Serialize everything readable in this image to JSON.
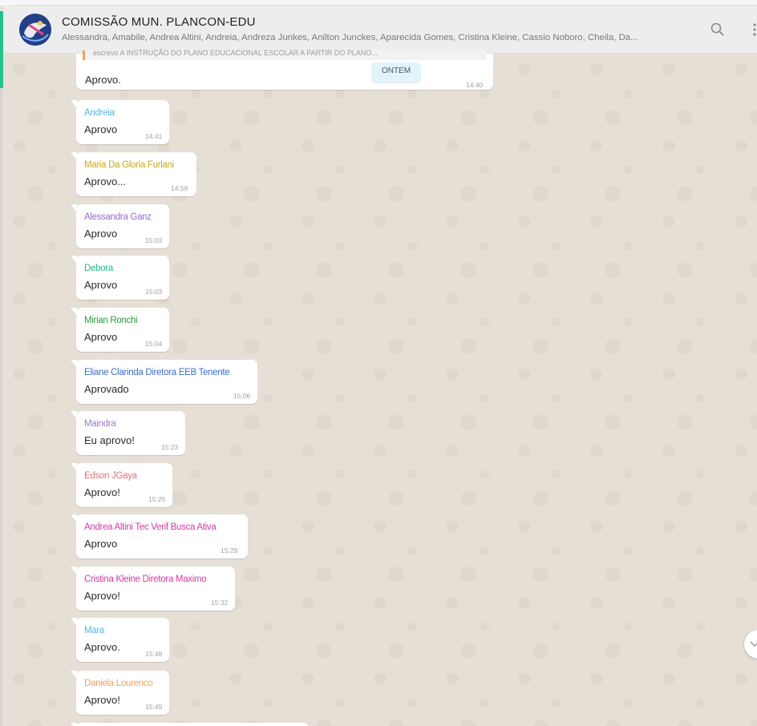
{
  "header": {
    "group_title": "COMISSÃO MUN. PLANCON-EDU",
    "members": "Alessandra, Amabile, Andrea Altini, Andreia, Andreza Junkes, Anilton Junckes, Aparecida Gomes, Cristina Kleine, Cassio Noboro, Cheila, Da..."
  },
  "icons": {
    "avatar": "group-avatar",
    "search": "search-icon",
    "menu": "menu-icon",
    "scroll_down": "chevron-down-icon"
  },
  "first_message": {
    "quote": "escrevo A INSTRUÇÃO DO PLANO EDUCACIONAL ESCOLAR A PARTIR DO PLANO...",
    "text": "Aprovo.",
    "time": "14:40"
  },
  "date_badge": "ONTEM",
  "messages": [
    {
      "sender": "Andreia",
      "color": "#5bb4df",
      "text": "Aprovo",
      "time": "14:41"
    },
    {
      "sender": "Maria Da Gloria Furlani",
      "color": "#c9a91b",
      "text": "Aprovo...",
      "time": "14:59"
    },
    {
      "sender": "Alessandra Ganz",
      "color": "#8c6fd1",
      "text": "Aprovo",
      "time": "15:03"
    },
    {
      "sender": "Debora",
      "color": "#2ab88a",
      "text": "Aprovo",
      "time": "15:03"
    },
    {
      "sender": "Mirian Ronchi",
      "color": "#2c9a3d",
      "text": "Aprovo",
      "time": "15:04"
    },
    {
      "sender": "Eliane Clarinda Diretora EEB Tenente",
      "color": "#3a6fc9",
      "text": "Aprovado",
      "time": "15:06"
    },
    {
      "sender": "Maindra",
      "color": "#9b7ad0",
      "text": "Eu aprovo!",
      "time": "15:23"
    },
    {
      "sender": "Edson JGaya",
      "color": "#e2707a",
      "text": "Aprovo!",
      "time": "15:25"
    },
    {
      "sender": "Andrea Altini Tec Verif Busca Ativa",
      "color": "#d63aa6",
      "text": "Aprovo",
      "time": "15:29"
    },
    {
      "sender": "Cristina Kleine Diretora Maximo",
      "color": "#d63aa6",
      "text": "Aprovo!",
      "time": "15:32"
    },
    {
      "sender": "Mara",
      "color": "#5bb4df",
      "text": "Aprovo.",
      "time": "15:48"
    },
    {
      "sender": "Daniela Lourenco",
      "color": "#f0a25a",
      "text": "Aprovo!",
      "time": "15:49"
    }
  ]
}
